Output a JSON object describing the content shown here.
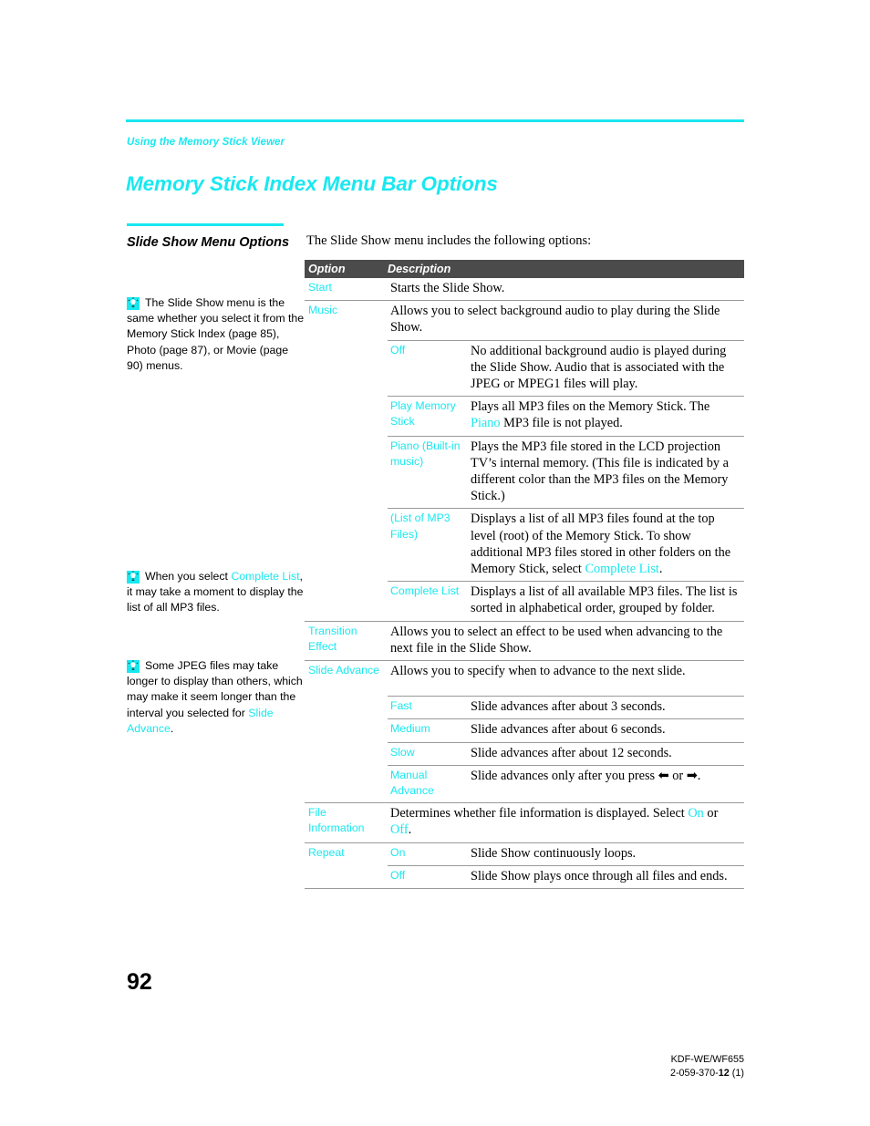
{
  "header": {
    "breadcrumb": "Using the Memory Stick Viewer",
    "title": "Memory Stick Index Menu Bar Options"
  },
  "sidebar": {
    "heading": "Slide Show Menu Options",
    "notes": [
      {
        "icon": "tip-bulb-icon",
        "text": "The Slide Show menu is the same whether you select it from the Memory Stick Index (page 85), Photo (page 87), or Movie (page 90) menus."
      },
      {
        "icon": "tip-bulb-icon",
        "text_before": "When you select ",
        "link": "Complete List",
        "text_after": ", it may take a moment to display the list of all MP3 files."
      },
      {
        "icon": "tip-bulb-icon",
        "text_before": "Some JPEG files may take longer to display than others, which may make it seem longer than the interval you selected for ",
        "link": "Slide Advance",
        "text_after": "."
      }
    ]
  },
  "main": {
    "intro": "The Slide Show menu includes the following options:",
    "table": {
      "columns": [
        "Option",
        "Description"
      ],
      "rows": [
        {
          "option": "Start",
          "description": "Starts the Slide Show."
        },
        {
          "option": "Music",
          "description": "Allows you to select background audio to play during the Slide Show.",
          "subrows": [
            {
              "option": "Off",
              "description": "No additional background audio is played during the Slide Show. Audio that is associated with the JPEG or MPEG1 files will play."
            },
            {
              "option": "Play Memory Stick",
              "description_before": "Plays all MP3 files on the Memory Stick. The ",
              "link": "Piano",
              "description_after": " MP3 file is not played."
            },
            {
              "option": "Piano (Built-in music)",
              "description": "Plays the MP3 file stored in the LCD projection TV’s internal memory. (This file is indicated by a different color than the MP3 files on the Memory Stick.)"
            },
            {
              "option": "(List of MP3 Files)",
              "description_before": "Displays a list of all MP3 files found at the top level (root) of the Memory Stick. To show additional MP3 files stored in other folders on the Memory Stick, select ",
              "link": "Complete List",
              "description_after": "."
            },
            {
              "option": "Complete List",
              "description": "Displays a list of all available MP3 files. The list is sorted in alphabetical order, grouped by folder."
            }
          ]
        },
        {
          "option": "Transition Effect",
          "description": "Allows you to select an effect to be used when advancing to the next file in the Slide Show."
        },
        {
          "option": "Slide Advance",
          "description": "Allows you to specify when to advance to the next slide.",
          "subrows": [
            {
              "option": "Fast",
              "description": "Slide advances after about 3 seconds."
            },
            {
              "option": "Medium",
              "description": "Slide advances after about 6 seconds."
            },
            {
              "option": "Slow",
              "description": "Slide advances after about 12 seconds."
            },
            {
              "option": "Manual Advance",
              "description_before": "Slide advances only after you press ",
              "arrow_left": "⬅",
              "description_mid": " or ",
              "arrow_right": "➡",
              "description_after": "."
            }
          ]
        },
        {
          "option": "File Information",
          "description_before": "Determines whether file information is displayed. Select ",
          "link": "On",
          "description_mid": " or ",
          "link2": "Off",
          "description_after": "."
        },
        {
          "option": "Repeat",
          "subrows": [
            {
              "option": "On",
              "description": "Slide Show continuously loops."
            },
            {
              "option": "Off",
              "description": "Slide Show plays once through all files and ends."
            }
          ]
        }
      ]
    }
  },
  "footer": {
    "page_number": "92",
    "model": "KDF-WE/WF655",
    "doc_number_prefix": "2-059-370-",
    "doc_number_bold": "12",
    "doc_number_suffix": " (1)"
  },
  "colors": {
    "accent_cyan": "#19e8f0",
    "header_bar": "#4b4b4b",
    "rule": "#9a9a9a"
  }
}
